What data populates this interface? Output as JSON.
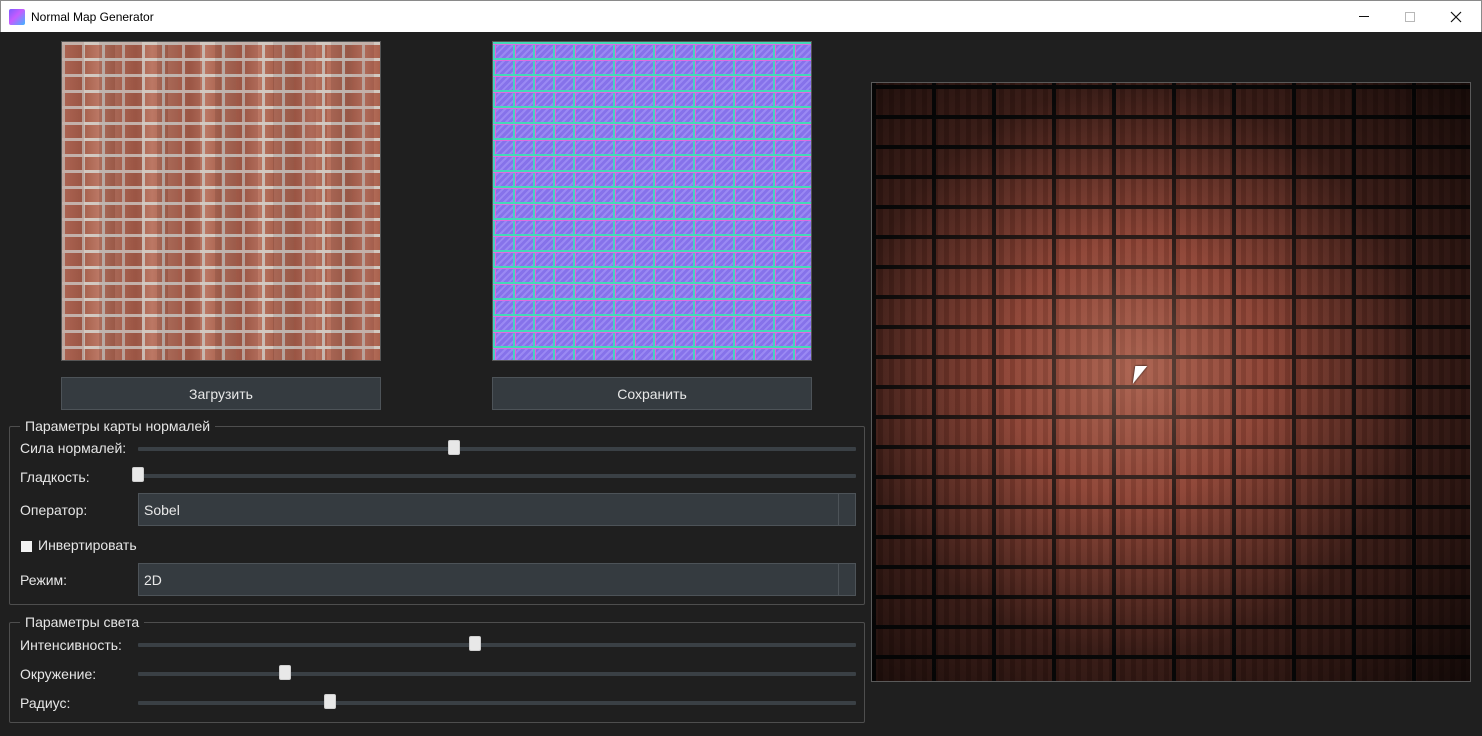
{
  "window": {
    "title": "Normal Map Generator",
    "icon": "app-gradient-icon",
    "controls": [
      "minimize-icon",
      "maximize-icon",
      "close-icon"
    ]
  },
  "images": {
    "source": "brick-texture",
    "normal_map": "normal-map-texture",
    "preview": "lit-brick-preview"
  },
  "buttons": {
    "load_label": "Загрузить",
    "save_label": "Сохранить"
  },
  "normal_params": {
    "title": "Параметры карты нормалей",
    "strength": {
      "label": "Сила нормалей:",
      "value": 0.44
    },
    "smoothness": {
      "label": "Гладкость:",
      "value": 0.0
    },
    "operator": {
      "label": "Оператор:",
      "value": "Sobel"
    },
    "invert": {
      "label": "Инвертировать",
      "checked": false
    },
    "mode": {
      "label": "Режим:",
      "value": "2D"
    }
  },
  "light_params": {
    "title": "Параметры света",
    "intensity": {
      "label": "Интенсивность:",
      "value": 0.47
    },
    "ambient": {
      "label": "Окружение:",
      "value": 0.205
    },
    "radius": {
      "label": "Радиус:",
      "value": 0.267
    }
  },
  "colors": {
    "background": "#1f1f1f",
    "control": "#353b40",
    "text": "#e6e6e6"
  }
}
